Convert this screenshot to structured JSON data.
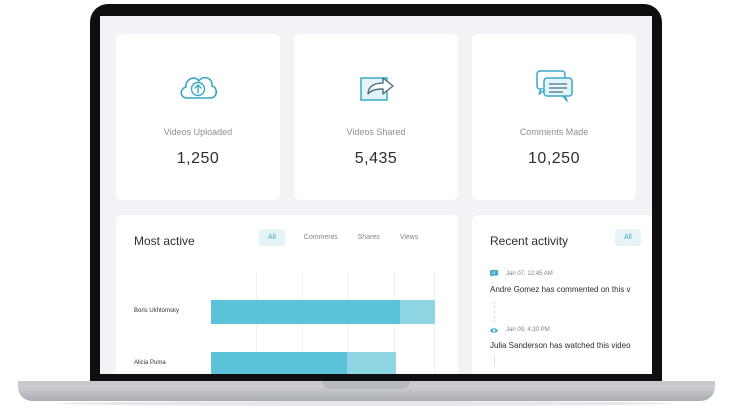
{
  "stats": [
    {
      "label": "Videos Uploaded",
      "value": "1,250",
      "icon": "cloud-upload-icon"
    },
    {
      "label": "Videos Shared",
      "value": "5,435",
      "icon": "share-arrow-icon"
    },
    {
      "label": "Comments Made",
      "value": "10,250",
      "icon": "chat-bubbles-icon"
    }
  ],
  "most_active": {
    "title": "Most active",
    "tabs": [
      "All",
      "Comments",
      "Shares",
      "Views"
    ],
    "selected_tab": "All",
    "users": [
      {
        "name": "Boris Ukhtomsky"
      },
      {
        "name": "Alicia Puma"
      }
    ]
  },
  "recent_activity": {
    "title": "Recent activity",
    "filter": "All",
    "items": [
      {
        "date": "Jan 07, 12:45 AM",
        "text": "Andre Gomez has commented on this v",
        "icon": "comment-icon"
      },
      {
        "date": "Jan 09, 4:30 PM",
        "text": "Julia Sanderson has watched this video",
        "icon": "eye-icon"
      }
    ]
  },
  "colors": {
    "accent": "#3aa9c7",
    "bar_dark": "#5bc3d9",
    "bar_light": "#8fd6e5"
  }
}
